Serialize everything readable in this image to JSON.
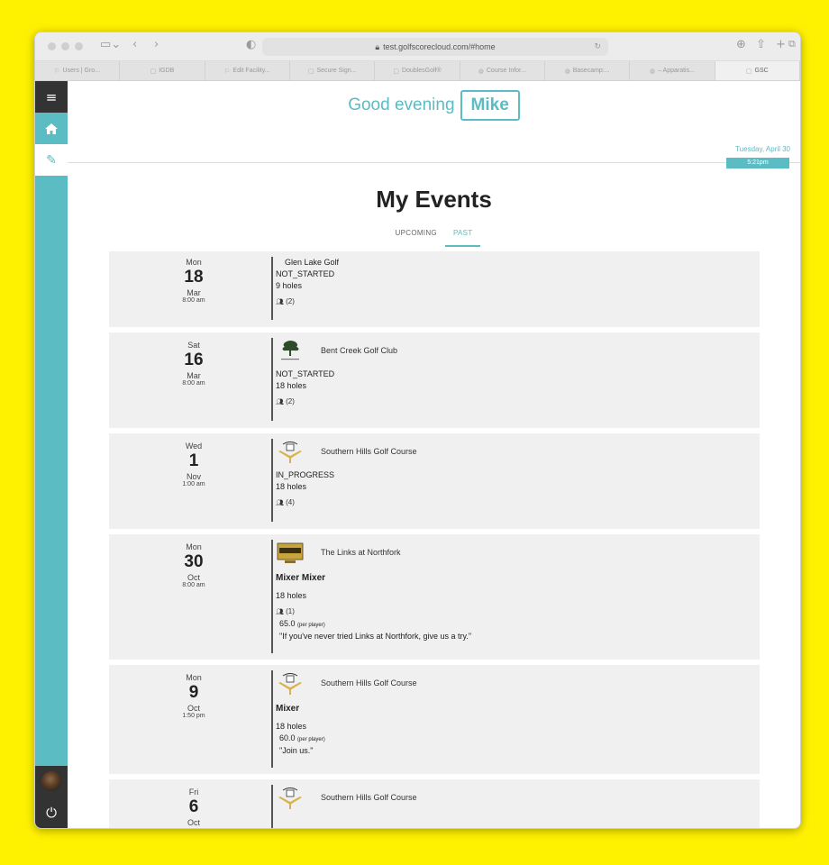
{
  "browser": {
    "url": "test.golfscorecloud.com/#home",
    "tabs": [
      {
        "label": "Users | Gro...",
        "icon": "golf-flag-icon"
      },
      {
        "label": "IGDB",
        "icon": "page-icon"
      },
      {
        "label": "Edit Facility...",
        "icon": "golf-flag-icon"
      },
      {
        "label": "Secure Sign...",
        "icon": "page-icon"
      },
      {
        "label": "DoublesGolf®",
        "icon": "page-icon"
      },
      {
        "label": "Course Infor...",
        "icon": "globe-icon"
      },
      {
        "label": "Basecamp:...",
        "icon": "globe-icon"
      },
      {
        "label": "– Apparatis...",
        "icon": "globe-icon"
      },
      {
        "label": "GSC",
        "icon": "page-icon"
      }
    ]
  },
  "greeting": {
    "text": "Good evening",
    "name": "Mike"
  },
  "header": {
    "date": "Tuesday, April 30",
    "time": "5:21pm"
  },
  "page": {
    "title": "My Events"
  },
  "tabs": {
    "upcoming": "UPCOMING",
    "past": "PAST"
  },
  "colors": {
    "accent": "#5bbcc3",
    "sidebar_dark": "#333333"
  },
  "events": [
    {
      "dow": "Mon",
      "day": "18",
      "month": "Mar",
      "time": "8:00 am",
      "course": "Glen Lake Golf",
      "status": "NOT_STARTED",
      "holes": "9 holes",
      "players": "(2)"
    },
    {
      "dow": "Sat",
      "day": "16",
      "month": "Mar",
      "time": "8:00 am",
      "course": "Bent Creek Golf Club",
      "status": "NOT_STARTED",
      "holes": "18 holes",
      "players": "(2)"
    },
    {
      "dow": "Wed",
      "day": "1",
      "month": "Nov",
      "time": "1:00 am",
      "course": "Southern Hills Golf Course",
      "status": "IN_PROGRESS",
      "holes": "18 holes",
      "players": "(4)"
    },
    {
      "dow": "Mon",
      "day": "30",
      "month": "Oct",
      "time": "8:00 am",
      "course": "The Links at Northfork",
      "name": "Mixer Mixer",
      "holes": "18 holes",
      "players": "(1)",
      "price": "65.0",
      "price_unit": "(per player)",
      "description": "\"If you've never tried Links at Northfork, give us a try.\""
    },
    {
      "dow": "Mon",
      "day": "9",
      "month": "Oct",
      "time": "1:50 pm",
      "course": "Southern Hills Golf Course",
      "name": "Mixer",
      "holes": "18 holes",
      "price": "60.0",
      "price_unit": "(per player)",
      "description": "\"Join us.\""
    },
    {
      "dow": "Fri",
      "day": "6",
      "month": "Oct",
      "course": "Southern Hills Golf Course"
    }
  ]
}
